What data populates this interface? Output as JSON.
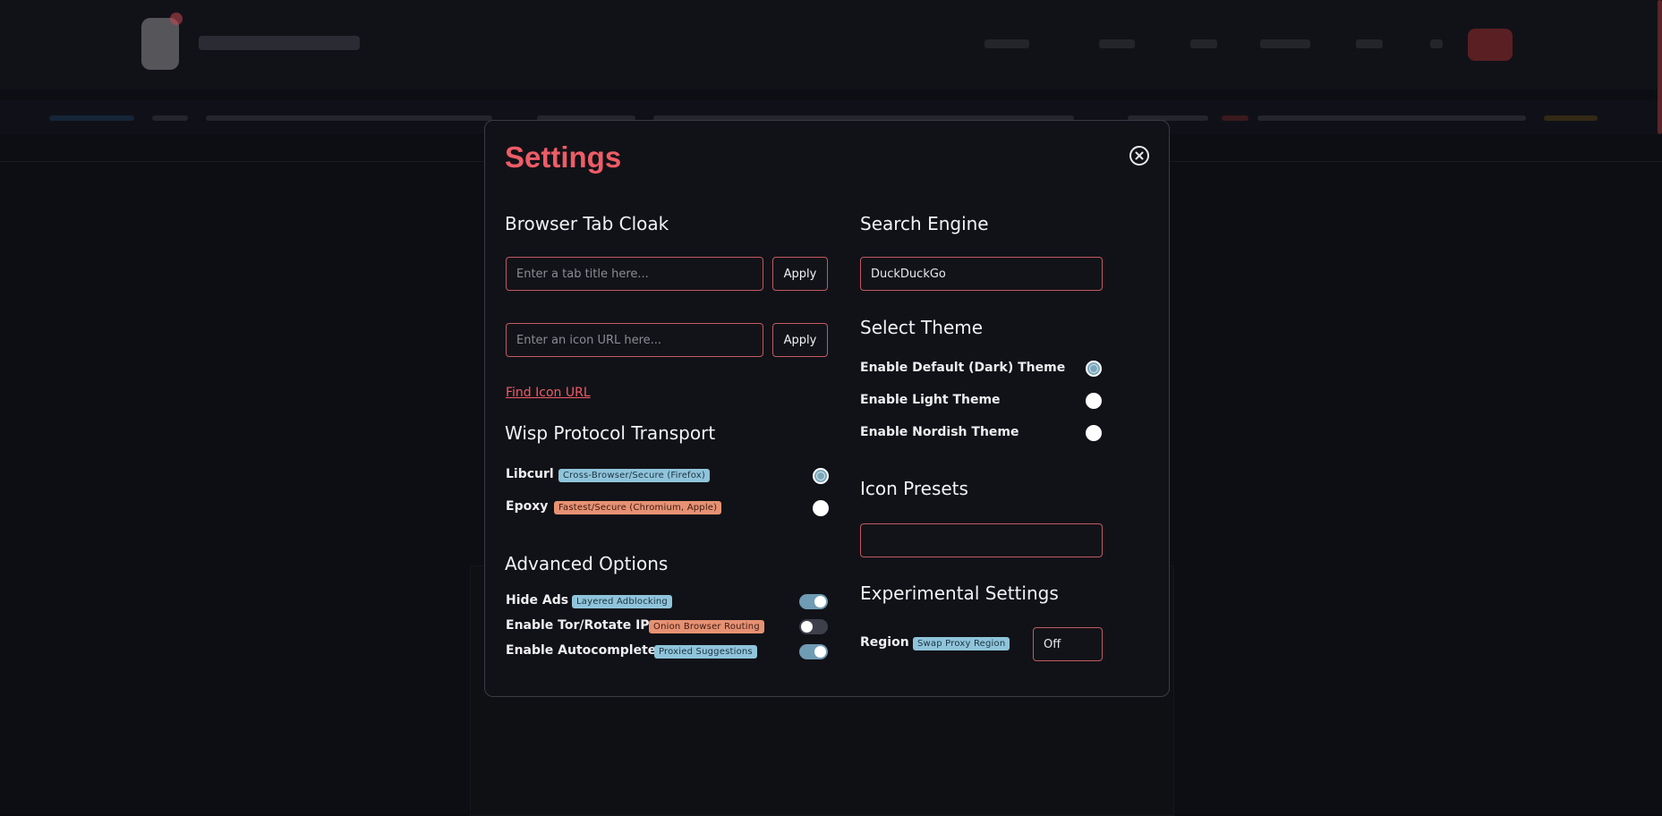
{
  "modal": {
    "title": "Settings",
    "close_icon": "close-circle-icon"
  },
  "tab_cloak": {
    "title": "Browser Tab Cloak",
    "title_input_placeholder": "Enter a tab title here...",
    "icon_input_placeholder": "Enter an icon URL here...",
    "apply_label": "Apply",
    "find_icon_link": "Find Icon URL"
  },
  "wisp": {
    "title": "Wisp Protocol Transport",
    "options": [
      {
        "label": "Libcurl",
        "badge": "Cross-Browser/Secure (Firefox)",
        "badge_color": "#8fc4db",
        "selected": true
      },
      {
        "label": "Epoxy",
        "badge": "Fastest/Secure (Chromium, Apple)",
        "badge_color": "#e79173",
        "selected": false
      }
    ]
  },
  "advanced": {
    "title": "Advanced Options",
    "options": [
      {
        "label": "Hide Ads",
        "badge": "Layered Adblocking",
        "badge_color": "#8fc4db",
        "enabled": true
      },
      {
        "label": "Enable Tor/Rotate IP",
        "badge": "Onion Browser Routing",
        "badge_color": "#e79173",
        "enabled": false
      },
      {
        "label": "Enable Autocomplete",
        "badge": "Proxied Suggestions",
        "badge_color": "#8fc4db",
        "enabled": true
      }
    ]
  },
  "search_engine": {
    "title": "Search Engine",
    "value": "DuckDuckGo"
  },
  "theme": {
    "title": "Select Theme",
    "options": [
      {
        "label": "Enable Default (Dark) Theme",
        "selected": true
      },
      {
        "label": "Enable Light Theme",
        "selected": false
      },
      {
        "label": "Enable Nordish Theme",
        "selected": false
      }
    ]
  },
  "icon_presets": {
    "title": "Icon Presets",
    "value": ""
  },
  "experimental": {
    "title": "Experimental Settings",
    "region_label": "Region",
    "region_badge": "Swap Proxy Region",
    "region_value": "Off"
  },
  "colors": {
    "accent": "#ee5c67",
    "badge_blue": "#8fc4db",
    "badge_orange": "#e79173",
    "toggle_on": "#6f9bb4"
  }
}
